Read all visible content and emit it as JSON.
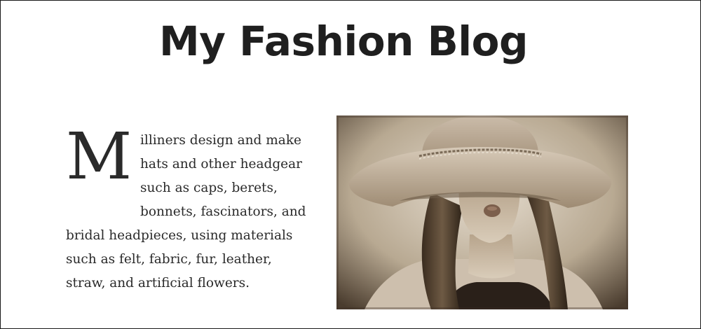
{
  "page": {
    "title": "My Fashion Blog"
  },
  "article": {
    "dropcap": "M",
    "body": "illiners design and make hats and other headgear such as caps, berets, bonnets, fascinators, and bridal headpieces, using materials such as felt, fabric, fur, leather, straw, and artificial flowers."
  },
  "photo": {
    "description_icon": "hat-woman-photo",
    "tone_dark": "#2c2218",
    "tone_mid": "#8a7a66",
    "tone_light": "#d8cfc2"
  }
}
